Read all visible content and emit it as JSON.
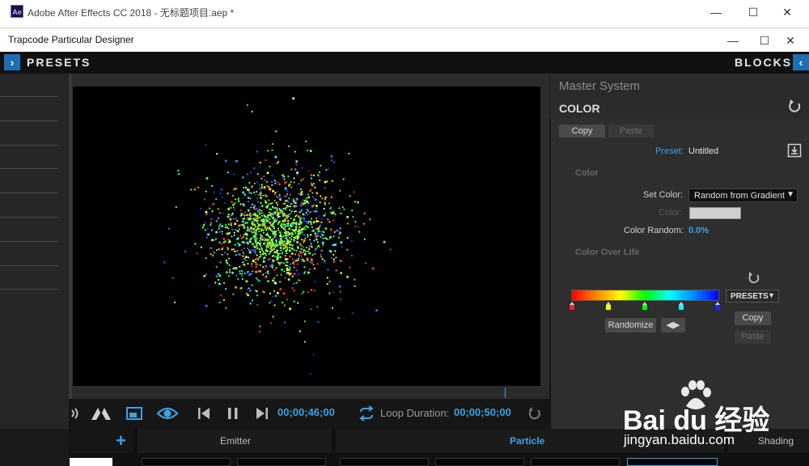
{
  "ae_window": {
    "icon_text": "Ae",
    "title": "Adobe After Effects CC 2018 - 无标题项目.aep *",
    "minimize": "—",
    "maximize": "☐",
    "close": "✕"
  },
  "designer_window": {
    "title": "Trapcode Particular Designer",
    "minimize": "—",
    "maximize": "☐",
    "close": "✕"
  },
  "header": {
    "presets_label": "PRESETS",
    "blocks_label": "BLOCKS",
    "left_arrow": "›",
    "right_arrow": "‹"
  },
  "transport": {
    "current_time": "00;00;46;00",
    "loop_label": "Loop Duration:",
    "loop_time": "00;00;50;00"
  },
  "right_panel": {
    "section_title": "Master System",
    "block_title": "COLOR",
    "copy_label": "Copy",
    "paste_label": "Paste",
    "preset_label": "Preset:",
    "preset_value": "Untitled",
    "color_group": "Color",
    "set_color_label": "Set Color:",
    "set_color_value": "Random from Gradient",
    "color_label": "Color:",
    "color_random_label": "Color Random:",
    "color_random_value": "0.0%",
    "color_over_life": "Color Over Life",
    "presets_dropdown": "PRESETS",
    "gradient_copy": "Copy",
    "gradient_paste": "Paste",
    "randomize_label": "Randomize",
    "gradient_stops": [
      "#ff2020",
      "#ffff00",
      "#00ff00",
      "#00ffff",
      "#2020ff"
    ]
  },
  "bottom_tabs": {
    "add": "+",
    "emitter": "Emitter",
    "particle": "Particle",
    "shading": "Shading"
  },
  "colors": {
    "accent": "#3aa3e3",
    "header_bg": "#111111",
    "panel_bg": "#2e2e2e"
  },
  "watermark": {
    "brand": "Bai du 经验",
    "url": "jingyan.baidu.com"
  }
}
